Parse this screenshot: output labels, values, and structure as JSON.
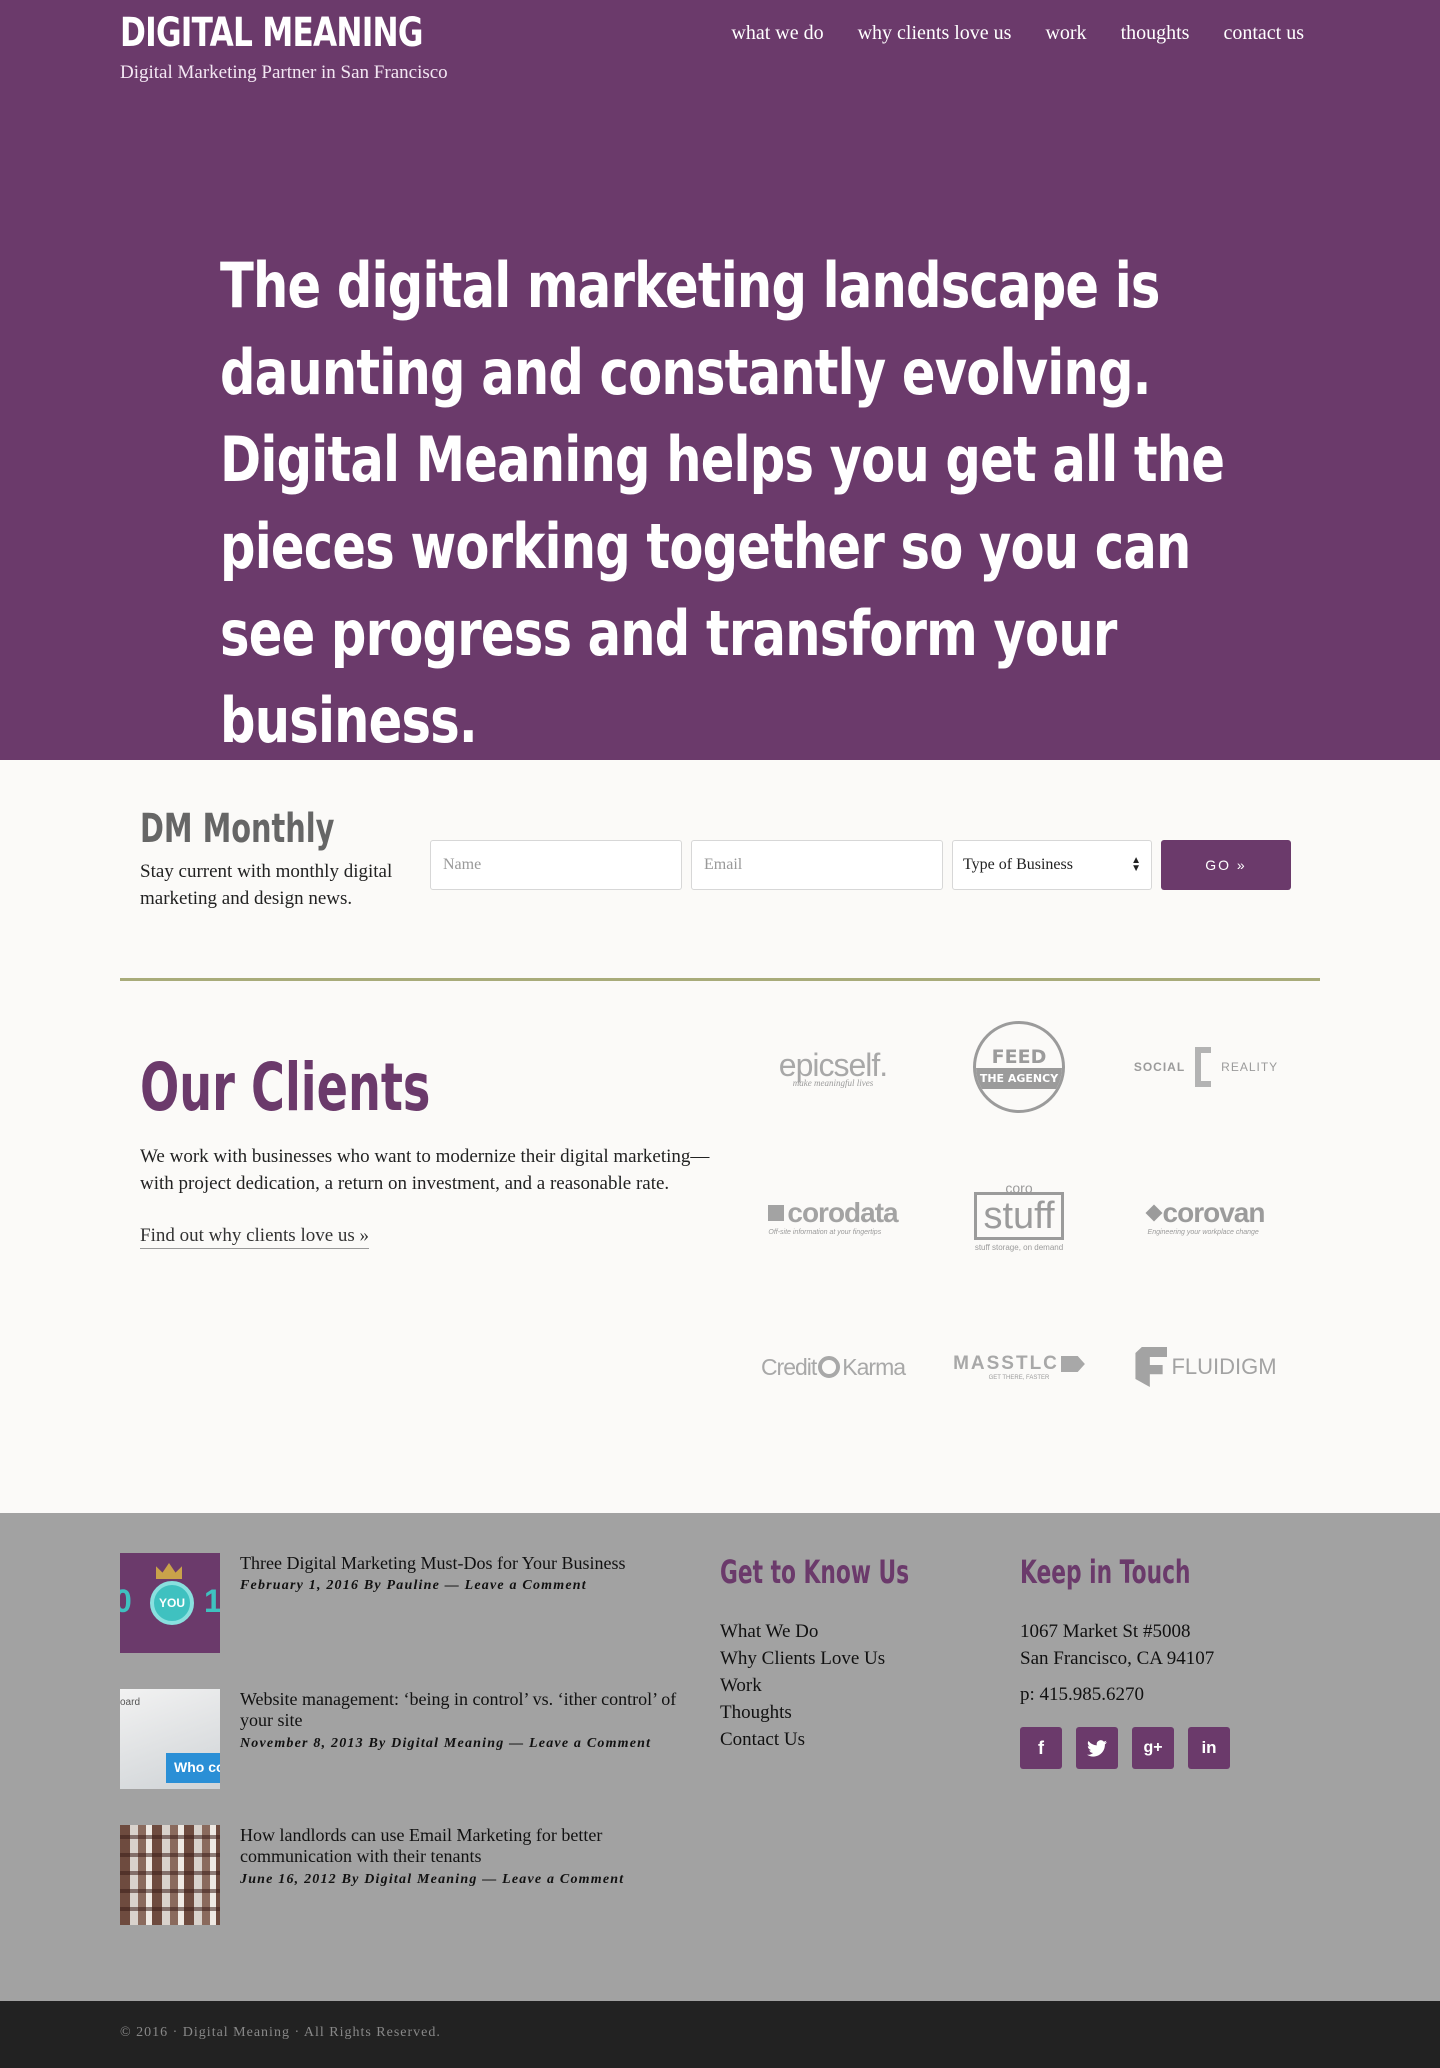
{
  "header": {
    "title": "DIGITAL MEANING",
    "tagline": "Digital Marketing Partner in San Francisco",
    "nav": [
      "what we do",
      "why clients love us",
      "work",
      "thoughts",
      "contact us"
    ]
  },
  "hero": {
    "text": "The digital marketing landscape is daunting and constantly evolving. Digital Meaning helps you get all the pieces working together so you can see progress and transform your business."
  },
  "newsletter": {
    "title": "DM Monthly",
    "description": "Stay current with monthly digital marketing and design news.",
    "name_placeholder": "Name",
    "email_placeholder": "Email",
    "business_select": "Type of Business",
    "go_label": "GO »"
  },
  "clients": {
    "title": "Our Clients",
    "description": "We work with businesses who want to modernize their digital marketing—with project dedication, a return on investment, and a reasonable rate.",
    "link": "Find out why clients love us »",
    "logos": [
      {
        "main": "epicself.",
        "sub": "make meaningful lives"
      },
      {
        "main": "FEED",
        "sub": "THE AGENCY"
      },
      {
        "main": "SOCIAL",
        "sub": "REALITY"
      },
      {
        "main": "corodata",
        "sub": "Off-site information at your fingertips"
      },
      {
        "main": "stuff",
        "top": "coro",
        "sub": "stuff storage, on demand"
      },
      {
        "main": "corovan",
        "sub": "Engineering your workplace change"
      },
      {
        "main": "Credit",
        "sub": "Karma"
      },
      {
        "main": "MASSTLC",
        "sub": "GET THERE, FASTER"
      },
      {
        "main": "FLUIDIGM",
        "sub": ""
      }
    ]
  },
  "footer": {
    "posts": [
      {
        "title": "Three Digital Marketing Must-Dos for Your Business",
        "meta": "February 1, 2016 By Pauline — Leave a Comment",
        "thumb_text": "YOU"
      },
      {
        "title": "Website management: ‘being in control’ vs. ‘ither control’ of your site",
        "meta": "November 8, 2013 By Digital Meaning — Leave a Comment",
        "thumb_text": "Who con"
      },
      {
        "title": "How landlords can use Email Marketing for better communication with their tenants",
        "meta": "June 16, 2012 By Digital Meaning — Leave a Comment",
        "thumb_text": ""
      }
    ],
    "know_heading": "Get to Know Us",
    "know_links": [
      "What We Do",
      "Why Clients Love Us",
      "Work",
      "Thoughts",
      "Contact Us"
    ],
    "touch_heading": "Keep in Touch",
    "address_line1": "1067 Market St #5008",
    "address_line2": "San Francisco, CA 94107",
    "phone": "p: 415.985.6270",
    "social": [
      "f",
      "t",
      "g+",
      "in"
    ],
    "copyright": "© 2016 · Digital Meaning · All Rights Reserved."
  },
  "colors": {
    "brand": "#6b3a6b",
    "accent_line": "#a8ab7a",
    "footer_bg": "#a2a2a2"
  }
}
